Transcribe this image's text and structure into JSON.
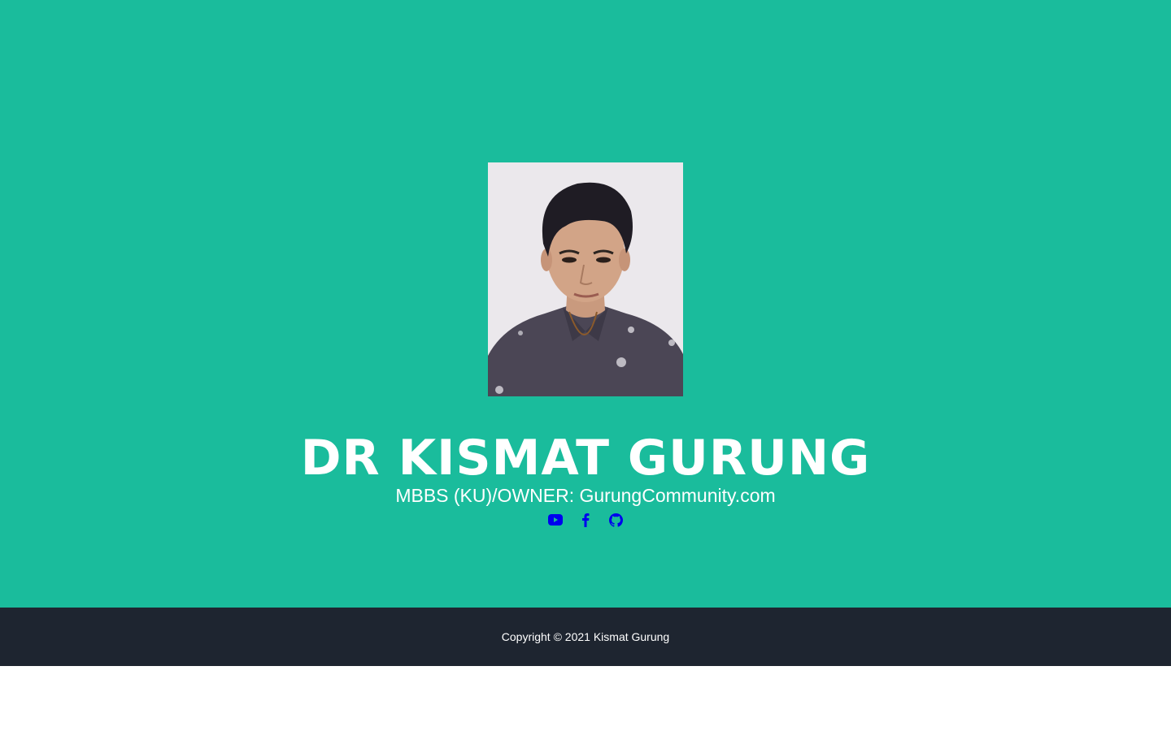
{
  "profile": {
    "name": "DR KISMAT GURUNG",
    "subtitle": "MBBS (KU)/OWNER: GurungCommunity.com",
    "photo_icon": "portrait-photo"
  },
  "social": {
    "items": [
      {
        "icon": "youtube-icon"
      },
      {
        "icon": "facebook-icon"
      },
      {
        "icon": "github-icon"
      }
    ],
    "color": "#0000ee"
  },
  "footer": {
    "copyright": "Copyright © 2021 Kismat Gurung"
  },
  "colors": {
    "hero_bg": "#1abc9c",
    "footer_bg": "#1e2530",
    "text": "#ffffff"
  }
}
